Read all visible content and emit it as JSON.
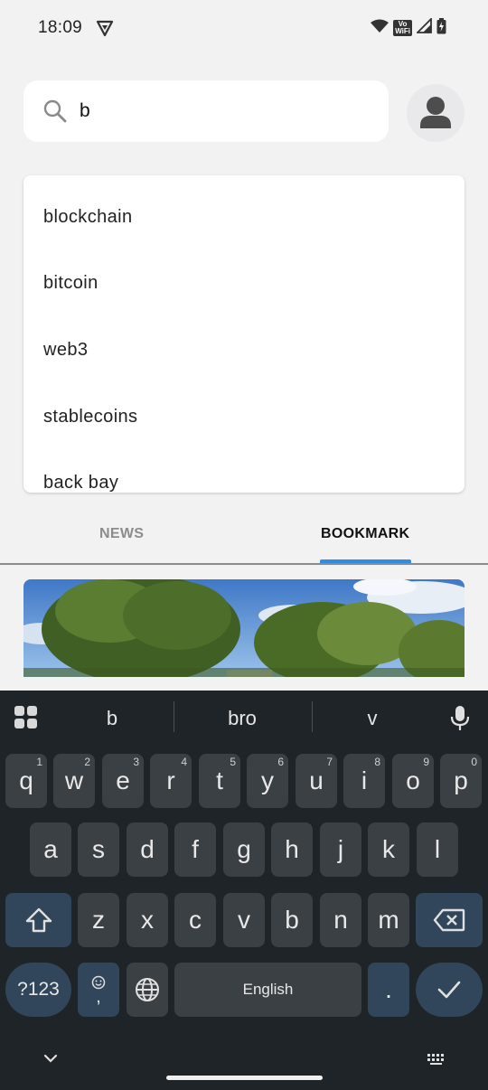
{
  "status_bar": {
    "time": "18:09",
    "volte_line1": "Vo",
    "volte_line2": "WiFi"
  },
  "search": {
    "value": "b",
    "placeholder": ""
  },
  "suggestions": [
    "blockchain",
    "bitcoin",
    "web3",
    "stablecoins",
    "back bay"
  ],
  "tabs": {
    "news": "NEWS",
    "bookmark": "BOOKMARK",
    "active": "bookmark"
  },
  "keyboard": {
    "word_suggestions": [
      "b",
      "bro",
      "v"
    ],
    "row1": [
      {
        "key": "q",
        "hint": "1"
      },
      {
        "key": "w",
        "hint": "2"
      },
      {
        "key": "e",
        "hint": "3"
      },
      {
        "key": "r",
        "hint": "4"
      },
      {
        "key": "t",
        "hint": "5"
      },
      {
        "key": "y",
        "hint": "6"
      },
      {
        "key": "u",
        "hint": "7"
      },
      {
        "key": "i",
        "hint": "8"
      },
      {
        "key": "o",
        "hint": "9"
      },
      {
        "key": "p",
        "hint": "0"
      }
    ],
    "row2": [
      "a",
      "s",
      "d",
      "f",
      "g",
      "h",
      "j",
      "k",
      "l"
    ],
    "row3": [
      "z",
      "x",
      "c",
      "v",
      "b",
      "n",
      "m"
    ],
    "symbols_label": "?123",
    "comma": ",",
    "space_label": "English",
    "period": "."
  },
  "colors": {
    "accent": "#2f8ce0",
    "keyboard_bg": "#1f2428",
    "key_bg": "#3b4045",
    "function_key_bg": "#31465a"
  },
  "icons": [
    "vpn-icon",
    "wifi-icon",
    "signal-icon",
    "battery-icon",
    "search-icon",
    "avatar-icon",
    "grid-icon",
    "mic-icon",
    "shift-icon",
    "backspace-icon",
    "emoji-icon",
    "globe-icon",
    "check-icon",
    "chevron-down-icon",
    "keyboard-icon"
  ]
}
